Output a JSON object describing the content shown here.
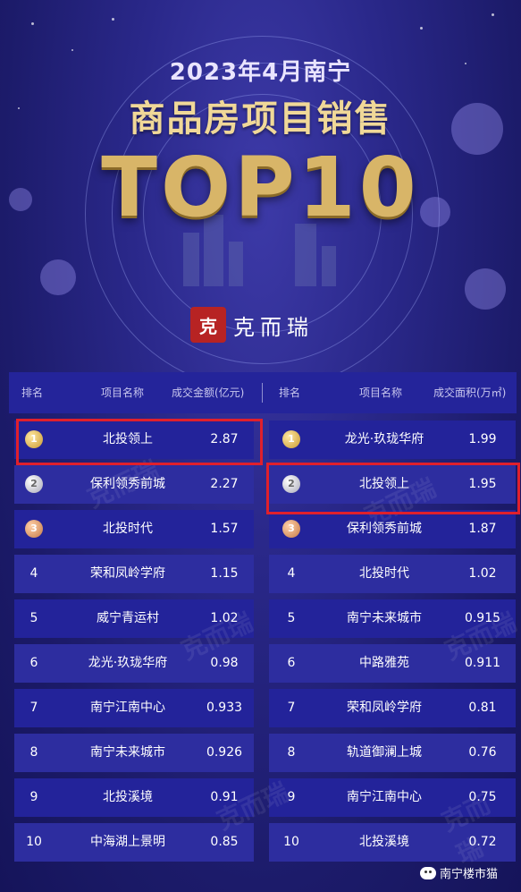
{
  "header": {
    "year_line": "2023年4月南宁",
    "title": "商品房项目销售",
    "top10": "TOP10",
    "brand_seal": "克",
    "brand_name": "克而瑞"
  },
  "left_table": {
    "headers": [
      "排名",
      "项目名称",
      "成交金额(亿元)"
    ],
    "rows": [
      {
        "rank": "1",
        "name": "北投领上",
        "value": "2.87"
      },
      {
        "rank": "2",
        "name": "保利领秀前城",
        "value": "2.27"
      },
      {
        "rank": "3",
        "name": "北投时代",
        "value": "1.57"
      },
      {
        "rank": "4",
        "name": "荣和凤岭学府",
        "value": "1.15"
      },
      {
        "rank": "5",
        "name": "威宁青运村",
        "value": "1.02"
      },
      {
        "rank": "6",
        "name": "龙光·玖珑华府",
        "value": "0.98"
      },
      {
        "rank": "7",
        "name": "南宁江南中心",
        "value": "0.933"
      },
      {
        "rank": "8",
        "name": "南宁未来城市",
        "value": "0.926"
      },
      {
        "rank": "9",
        "name": "北投溪境",
        "value": "0.91"
      },
      {
        "rank": "10",
        "name": "中海湖上景明",
        "value": "0.85"
      }
    ]
  },
  "right_table": {
    "headers": [
      "排名",
      "项目名称",
      "成交面积(万㎡)"
    ],
    "rows": [
      {
        "rank": "1",
        "name": "龙光·玖珑华府",
        "value": "1.99"
      },
      {
        "rank": "2",
        "name": "北投领上",
        "value": "1.95"
      },
      {
        "rank": "3",
        "name": "保利领秀前城",
        "value": "1.87"
      },
      {
        "rank": "4",
        "name": "北投时代",
        "value": "1.02"
      },
      {
        "rank": "5",
        "name": "南宁未来城市",
        "value": "0.915"
      },
      {
        "rank": "6",
        "name": "中路雅苑",
        "value": "0.911"
      },
      {
        "rank": "7",
        "name": "荣和凤岭学府",
        "value": "0.81"
      },
      {
        "rank": "8",
        "name": "轨道御澜上城",
        "value": "0.76"
      },
      {
        "rank": "9",
        "name": "南宁江南中心",
        "value": "0.75"
      },
      {
        "rank": "10",
        "name": "北投溪境",
        "value": "0.72"
      }
    ]
  },
  "watermark": "克而瑞",
  "footer": {
    "account": "南宁楼市猫",
    "icon": "wechat-icon"
  },
  "colors": {
    "background": "#1c1b6a",
    "row": "#23239a",
    "gold_text": "#f0d898",
    "highlight": "#e0202c"
  }
}
